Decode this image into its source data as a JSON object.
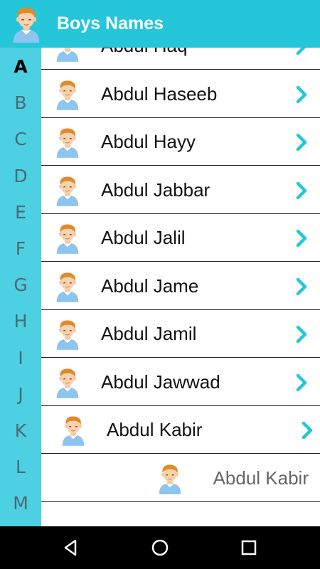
{
  "appbar": {
    "title": "Boys Names",
    "logo_icon": "boy-avatar-icon"
  },
  "colors": {
    "primary": "#26c6da",
    "sidebar": "#4dd0e1",
    "chevron": "#26c6da",
    "navbar": "#000000"
  },
  "index": {
    "letters": [
      "A",
      "B",
      "C",
      "D",
      "E",
      "F",
      "G",
      "H",
      "I",
      "J",
      "K",
      "L",
      "M"
    ],
    "selected": "A"
  },
  "list": {
    "rows": [
      {
        "name": "Abdul Haq"
      },
      {
        "name": "Abdul Haseeb"
      },
      {
        "name": "Abdul Hayy"
      },
      {
        "name": "Abdul Jabbar"
      },
      {
        "name": "Abdul Jalil"
      },
      {
        "name": "Abdul Jame"
      },
      {
        "name": "Abdul Jamil"
      },
      {
        "name": "Abdul Jawwad"
      },
      {
        "name": "Abdul Kabir"
      }
    ],
    "ghost_row": {
      "name": "Abdul Kabir"
    }
  },
  "navbar": {
    "buttons": [
      "back-icon",
      "home-icon",
      "recents-icon"
    ]
  }
}
